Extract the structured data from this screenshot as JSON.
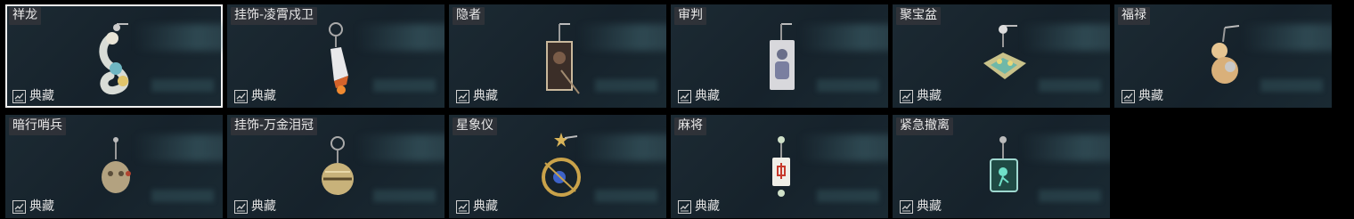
{
  "items": [
    {
      "name": "祥龙",
      "tag": "典藏",
      "icon": "dragon-charm-icon",
      "selected": true
    },
    {
      "name": "挂饰-凌霄戍卫",
      "tag": "典藏",
      "icon": "rocket-charm-icon"
    },
    {
      "name": "隐者",
      "tag": "典藏",
      "icon": "hermit-card-charm-icon"
    },
    {
      "name": "审判",
      "tag": "典藏",
      "icon": "judgement-card-charm-icon"
    },
    {
      "name": "聚宝盆",
      "tag": "典藏",
      "icon": "treasure-bowl-charm-icon"
    },
    {
      "name": "福禄",
      "tag": "典藏",
      "icon": "gourd-charm-icon"
    },
    {
      "name": "暗行哨兵",
      "tag": "典藏",
      "icon": "sentinel-charm-icon"
    },
    {
      "name": "挂饰-万金泪冠",
      "tag": "典藏",
      "icon": "golden-crown-charm-icon"
    },
    {
      "name": "星象仪",
      "tag": "典藏",
      "icon": "astrolabe-charm-icon"
    },
    {
      "name": "麻将",
      "tag": "典藏",
      "icon": "mahjong-tile-charm-icon"
    },
    {
      "name": "紧急撤离",
      "tag": "典藏",
      "icon": "exit-sign-charm-icon"
    }
  ],
  "colors": {
    "accent_border": "#f2f2f2",
    "card_bg": "#1c2a33",
    "label_bg": "#32343a"
  }
}
